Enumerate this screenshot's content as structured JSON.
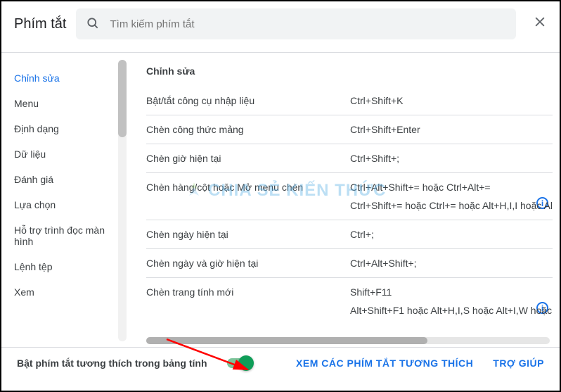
{
  "header": {
    "title": "Phím tắt",
    "search_placeholder": "Tìm kiếm phím tắt"
  },
  "sidebar": {
    "items": [
      {
        "label": "Chỉnh sửa",
        "active": true
      },
      {
        "label": "Menu"
      },
      {
        "label": "Định dạng"
      },
      {
        "label": "Dữ liệu"
      },
      {
        "label": "Đánh giá"
      },
      {
        "label": "Lựa chọn"
      },
      {
        "label": "Hỗ trợ trình đọc màn hình"
      },
      {
        "label": "Lệnh tệp"
      },
      {
        "label": "Xem"
      }
    ]
  },
  "content": {
    "section_title": "Chỉnh sửa",
    "rows": [
      {
        "label": "Bật/tắt công cụ nhập liệu",
        "value": "Ctrl+Shift+K"
      },
      {
        "label": "Chèn công thức mảng",
        "value": "Ctrl+Shift+Enter"
      },
      {
        "label": "Chèn giờ hiện tại",
        "value": "Ctrl+Shift+;"
      },
      {
        "label": "Chèn hàng/cột hoặc Mở menu chèn",
        "value": "Ctrl+Alt+Shift+= hoặc Ctrl+Alt+=",
        "value2": "Ctrl+Shift+= hoặc Ctrl+= hoặc Alt+H,I,I hoặc Al",
        "info": true
      },
      {
        "label": "Chèn ngày hiện tại",
        "value": "Ctrl+;"
      },
      {
        "label": "Chèn ngày và giờ hiện tại",
        "value": "Ctrl+Alt+Shift+;"
      },
      {
        "label": "Chèn trang tính mới",
        "value": "Shift+F11",
        "value2": "Alt+Shift+F1 hoặc Alt+H,I,S hoặc Alt+I,W hoặc",
        "info": true,
        "noborder": true
      }
    ]
  },
  "footer": {
    "toggle_label": "Bật phím tắt tương thích trong bảng tính",
    "link1": "XEM CÁC PHÍM TẮT TƯƠNG THÍCH",
    "link2": "TRỢ GIÚP"
  },
  "watermark": "CHIA SẺ KIẾN THỨC"
}
